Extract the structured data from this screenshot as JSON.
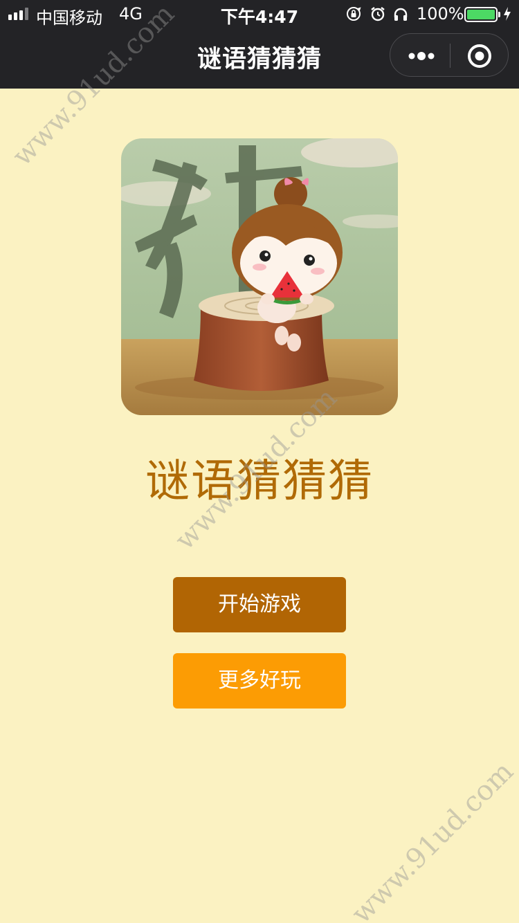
{
  "status_bar": {
    "carrier": "中国移动",
    "network": "4G",
    "time": "下午4:47",
    "battery_percent": "100%",
    "battery_level": 1.0,
    "signal_bars": 4,
    "signal_bars_active": 3,
    "icons": [
      "orientation-lock-icon",
      "alarm-icon",
      "headphones-icon",
      "battery-icon",
      "charging-bolt-icon"
    ]
  },
  "nav": {
    "title": "谜语猜猜猜",
    "capsule_icons": [
      "more-dots-icon",
      "close-target-icon"
    ]
  },
  "main": {
    "title": "谜语猜猜猜",
    "buttons": {
      "start": "开始游戏",
      "more": "更多好玩"
    }
  },
  "watermark": "www.91ud.com",
  "colors": {
    "page_bg": "#fbf2c2",
    "topbar_bg": "#232326",
    "title_color": "#b06a06",
    "start_button": "#b16504",
    "more_button": "#fc9c04",
    "battery_fill": "#4cd964"
  }
}
